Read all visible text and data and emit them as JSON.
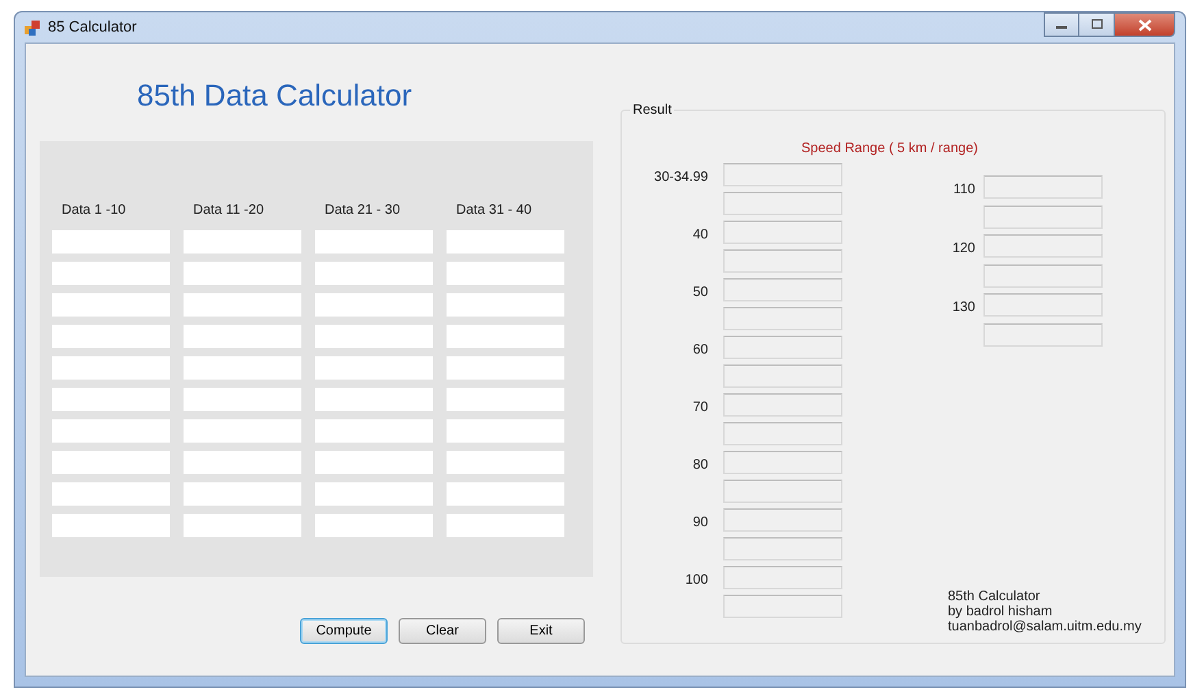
{
  "window": {
    "title": "85 Calculator"
  },
  "heading": "85th Data Calculator",
  "data_panel": {
    "columns": [
      {
        "header": "Data 1 -10",
        "fields": [
          {
            "kind": "textbox"
          },
          {
            "kind": "textbox"
          },
          {
            "kind": "textbox"
          },
          {
            "kind": "textbox"
          },
          {
            "kind": "textbox"
          },
          {
            "kind": "textbox"
          },
          {
            "kind": "textbox"
          },
          {
            "kind": "textbox"
          },
          {
            "kind": "textbox"
          },
          {
            "kind": "textbox"
          }
        ]
      },
      {
        "header": "Data 11 -20",
        "fields": [
          {
            "kind": "textbox"
          },
          {
            "kind": "textbox"
          },
          {
            "kind": "textbox"
          },
          {
            "kind": "textbox"
          },
          {
            "kind": "textbox"
          },
          {
            "kind": "textbox"
          },
          {
            "kind": "textbox"
          },
          {
            "kind": "textbox"
          },
          {
            "kind": "textbox"
          },
          {
            "kind": "textbox"
          }
        ]
      },
      {
        "header": "Data 21 - 30",
        "fields": [
          {
            "kind": "textbox"
          },
          {
            "kind": "textbox"
          },
          {
            "kind": "textbox"
          },
          {
            "kind": "textbox"
          },
          {
            "kind": "textbox"
          },
          {
            "kind": "textbox"
          },
          {
            "kind": "textbox"
          },
          {
            "kind": "textbox"
          },
          {
            "kind": "textbox"
          },
          {
            "kind": "textbox"
          }
        ]
      },
      {
        "header": "Data 31 - 40",
        "fields": [
          {
            "kind": "textbox"
          },
          {
            "kind": "textbox"
          },
          {
            "kind": "textbox"
          },
          {
            "kind": "textbox"
          },
          {
            "kind": "textbox"
          },
          {
            "kind": "textbox"
          },
          {
            "kind": "textbox"
          },
          {
            "kind": "textbox"
          },
          {
            "kind": "textbox"
          },
          {
            "kind": "textbox"
          }
        ]
      }
    ]
  },
  "buttons": [
    {
      "label": "Compute",
      "focused": true
    },
    {
      "label": "Clear",
      "focused": false
    },
    {
      "label": "Exit",
      "focused": false
    }
  ],
  "result": {
    "title": "Result",
    "subtitle": "Speed Range ( 5 km / range)",
    "columns": [
      {
        "ranges": [
          {
            "label": "30-34.99",
            "fields": [
              {
                "kind": "textbox"
              },
              {
                "kind": "textbox"
              }
            ]
          },
          {
            "label": "40",
            "fields": [
              {
                "kind": "textbox"
              },
              {
                "kind": "textbox"
              }
            ]
          },
          {
            "label": "50",
            "fields": [
              {
                "kind": "textbox"
              },
              {
                "kind": "textbox"
              }
            ]
          },
          {
            "label": "60",
            "fields": [
              {
                "kind": "textbox"
              },
              {
                "kind": "textbox"
              }
            ]
          },
          {
            "label": "70",
            "fields": [
              {
                "kind": "textbox"
              },
              {
                "kind": "textbox"
              }
            ]
          },
          {
            "label": "80",
            "fields": [
              {
                "kind": "textbox"
              },
              {
                "kind": "textbox"
              }
            ]
          },
          {
            "label": "90",
            "fields": [
              {
                "kind": "textbox"
              },
              {
                "kind": "textbox"
              }
            ]
          },
          {
            "label": "100",
            "fields": [
              {
                "kind": "textbox"
              },
              {
                "kind": "textbox"
              }
            ]
          }
        ]
      },
      {
        "ranges": [
          {
            "label": "110",
            "fields": [
              {
                "kind": "textbox"
              },
              {
                "kind": "textbox"
              }
            ]
          },
          {
            "label": "120",
            "fields": [
              {
                "kind": "textbox"
              },
              {
                "kind": "textbox"
              }
            ]
          },
          {
            "label": "130",
            "fields": [
              {
                "kind": "textbox"
              },
              {
                "kind": "textbox"
              }
            ]
          }
        ]
      }
    ],
    "credits": [
      "85th Calculator",
      "by badrol hisham",
      "tuanbadrol@salam.uitm.edu.my"
    ]
  }
}
